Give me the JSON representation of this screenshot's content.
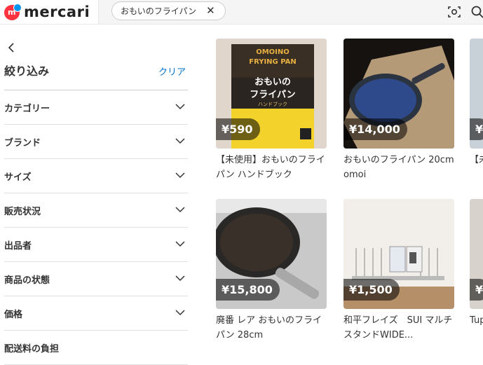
{
  "header": {
    "logo_text": "mercari",
    "logo_mark_letter": "m",
    "search_chip": "おもいのフライパン",
    "search_chip_close": "✕",
    "icons": [
      "camera-scan-icon",
      "search-icon"
    ]
  },
  "sidebar": {
    "back_icon": "chevron-left-icon",
    "title": "絞り込み",
    "clear_label": "クリア",
    "filters": [
      {
        "label": "カテゴリー"
      },
      {
        "label": "ブランド"
      },
      {
        "label": "サイズ"
      },
      {
        "label": "販売状況"
      },
      {
        "label": "出品者"
      },
      {
        "label": "商品の状態"
      },
      {
        "label": "価格"
      },
      {
        "label": "配送料の負担"
      }
    ]
  },
  "products": [
    {
      "price": "¥590",
      "name": "【未使用】おもいのフライパン ハンドブック",
      "thumb_text_1": "OMOINO",
      "thumb_text_2": "FRYING PAN",
      "thumb_text_3": "おもいの",
      "thumb_text_4": "フライパン",
      "thumb_text_5": "ハンドブック"
    },
    {
      "price": "¥14,000",
      "name": "おもいのフライパン 20cm omoi"
    },
    {
      "price": "¥15,800",
      "name": "廃番 レア おもいのフライパン 28cm"
    },
    {
      "price": "¥1,500",
      "name": "和平フレイズ　SUI マルチスタンドWIDE..."
    }
  ],
  "partial_cards": [
    {
      "price": "¥",
      "name": "【未 ン..."
    },
    {
      "price": "¥",
      "name": "Tup エフ"
    }
  ],
  "colors": {
    "accent_red": "#ff333f",
    "accent_blue": "#0095ee",
    "link_blue": "#0073cc"
  }
}
